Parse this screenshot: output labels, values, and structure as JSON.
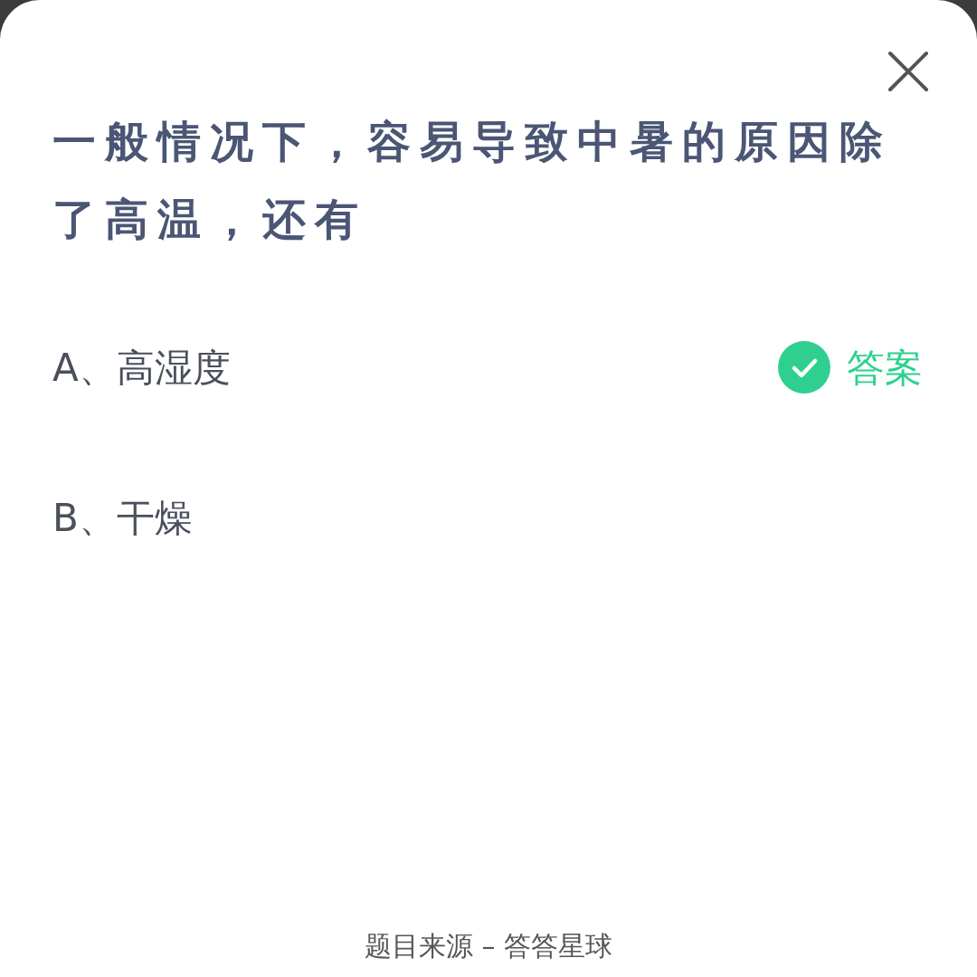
{
  "dialog": {
    "question": "一般情况下，容易导致中暑的原因除了高温，还有",
    "options": [
      {
        "label": "A、高湿度",
        "correct": true
      },
      {
        "label": "B、干燥",
        "correct": false
      }
    ],
    "answer_label": "答案",
    "footer": "题目来源 – 答答星球"
  }
}
